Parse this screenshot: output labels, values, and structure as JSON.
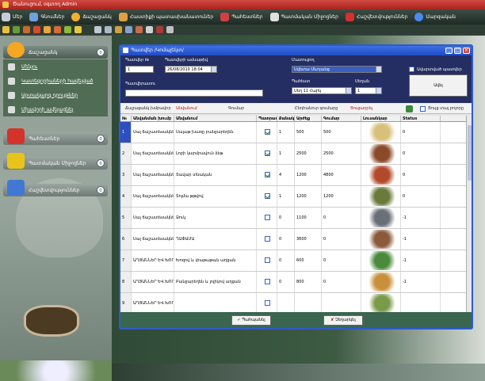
{
  "app": {
    "title": "Ծանուցում, օգտող Admin"
  },
  "menu": [
    {
      "label": "Մեր",
      "color": "#c8ccd8",
      "icon": "user-icon"
    },
    {
      "label": "Գնումներ",
      "color": "#6fa0e0",
      "icon": "people-icon"
    },
    {
      "label": "Ճաշացանկ",
      "color": "#f0b030",
      "icon": "orange-icon"
    },
    {
      "label": "Հաստիքի պատասխանատուներ",
      "color": "#e0a040",
      "icon": "staff-icon"
    },
    {
      "label": "Պահեստներ",
      "color": "#d04040",
      "icon": "chef-icon"
    },
    {
      "label": "Պատմական Միջոցներ",
      "color": "#e0e0e0",
      "icon": "dish-icon"
    },
    {
      "label": "Հաշվետվություններ",
      "color": "#d43030",
      "icon": "report-icon"
    },
    {
      "label": "Մարզական",
      "color": "#4a8af0",
      "icon": "globe-icon"
    }
  ],
  "sidebar": {
    "groups": [
      {
        "label": "Ճաշացանկ",
        "count": "0",
        "color": "#f5a623"
      },
      {
        "label": "Պահեստներ",
        "count": "0",
        "color": "#d4332a"
      },
      {
        "label": "Պատմական Միջոցներ",
        "count": "0",
        "color": "#e8c41a"
      },
      {
        "label": "Հաշվետվություններ",
        "count": "0",
        "color": "#4178d4"
      }
    ],
    "subs": [
      "Մենյու",
      "Կատեգորիաների հավելված",
      "Արտակարգ դրույթներ",
      "Միավորի ավելացնել"
    ]
  },
  "window": {
    "title": "Պատվեր /Կոմպլեկտ/",
    "labels": {
      "order_no": "Պատվեր №",
      "order_date": "Պատվերի ամսաթիվ",
      "waiter": "Մատուցող",
      "storage": "Պահեստ",
      "service": "Սրահ",
      "table": "Սեղան",
      "customer": "Պատվիրատու",
      "done_check": "Ավարտված պատվեր"
    },
    "values": {
      "order_no": "1",
      "order_date": "26/08/2010 18:04",
      "waiter": "Սվետա Սևոյանց",
      "storage": "Սեղ 11 Հարկ",
      "service": "1",
      "customer": ""
    },
    "done_button": "Ավել",
    "filter": {
      "category": "Ճաշացանկ խմբավոր",
      "category_value": "Անվանում",
      "price": "Գումար",
      "search": "Ընդհանուր գումարը",
      "search_value": "Ցուցադրել",
      "all": "Ցույց տալ բոլորը"
    },
    "columns": [
      "№",
      "Անվանման խումբ",
      "Անվանում",
      "Պատրաստ",
      "Քանակ",
      "Արժեք",
      "Գումար",
      "Լուսանկար",
      "Status"
    ],
    "rows": [
      {
        "n": "1",
        "group": "Սալ ճաշատեսակներ",
        "name": "Սալաթ խառը բանջարեղեն",
        "ready": true,
        "qty": "1",
        "price": "500",
        "sum": "500",
        "photo": "#d8c07a",
        "status": "0"
      },
      {
        "n": "2",
        "group": "Սալ ճաշատեսակներ",
        "name": "Լոբի կարմրավուն ձեթ",
        "ready": true,
        "qty": "1",
        "price": "2500",
        "sum": "2500",
        "photo": "#8a4a2a",
        "status": "0"
      },
      {
        "n": "3",
        "group": "Սալ ճաշատեսակներ",
        "name": "Տավար տնական",
        "ready": true,
        "qty": "4",
        "price": "1200",
        "sum": "4800",
        "photo": "#b24a2a",
        "status": "0"
      },
      {
        "n": "4",
        "group": "Սալ ճաշատեսակներ",
        "name": "Տոլմա թթվով",
        "ready": true,
        "qty": "1",
        "price": "1200",
        "sum": "1200",
        "photo": "#6a7a3a",
        "status": "0"
      },
      {
        "n": "5",
        "group": "Սալ ճաշատեսակներ",
        "name": "Ձուկ",
        "ready": false,
        "qty": "0",
        "price": "1100",
        "sum": "0",
        "photo": "#6a7078",
        "status": "-1"
      },
      {
        "n": "6",
        "group": "Սալ ճաշատեսակներ",
        "name": "ՂԱՓԱՄԱ",
        "ready": false,
        "qty": "0",
        "price": "3600",
        "sum": "0",
        "photo": "#8a5a3a",
        "status": "-1"
      },
      {
        "n": "7",
        "group": "ԱՂՑԱՆՆԵՐ ԵՎ ԽՈՐ...",
        "name": "Խոզով և փաթաթան աղցան",
        "ready": false,
        "qty": "0",
        "price": "600",
        "sum": "0",
        "photo": "#4a8a3a",
        "status": "-1"
      },
      {
        "n": "8",
        "group": "ԱՂՑԱՆՆԵՐ ԵՎ ԽՈՐ...",
        "name": "Բանջարեղեն և լոլիկով աղցան",
        "ready": false,
        "qty": "0",
        "price": "800",
        "sum": "0",
        "photo": "#c8903a",
        "status": "-1"
      },
      {
        "n": "9",
        "group": "ԱՂՑԱՆՆԵՐ ԵՎ ԽՈՐ...",
        "name": "",
        "ready": false,
        "qty": "",
        "price": "",
        "sum": "",
        "photo": "#7a9a4a",
        "status": ""
      }
    ],
    "footer": {
      "save": "Պահպանել",
      "cancel": "Չեղարկել"
    }
  }
}
